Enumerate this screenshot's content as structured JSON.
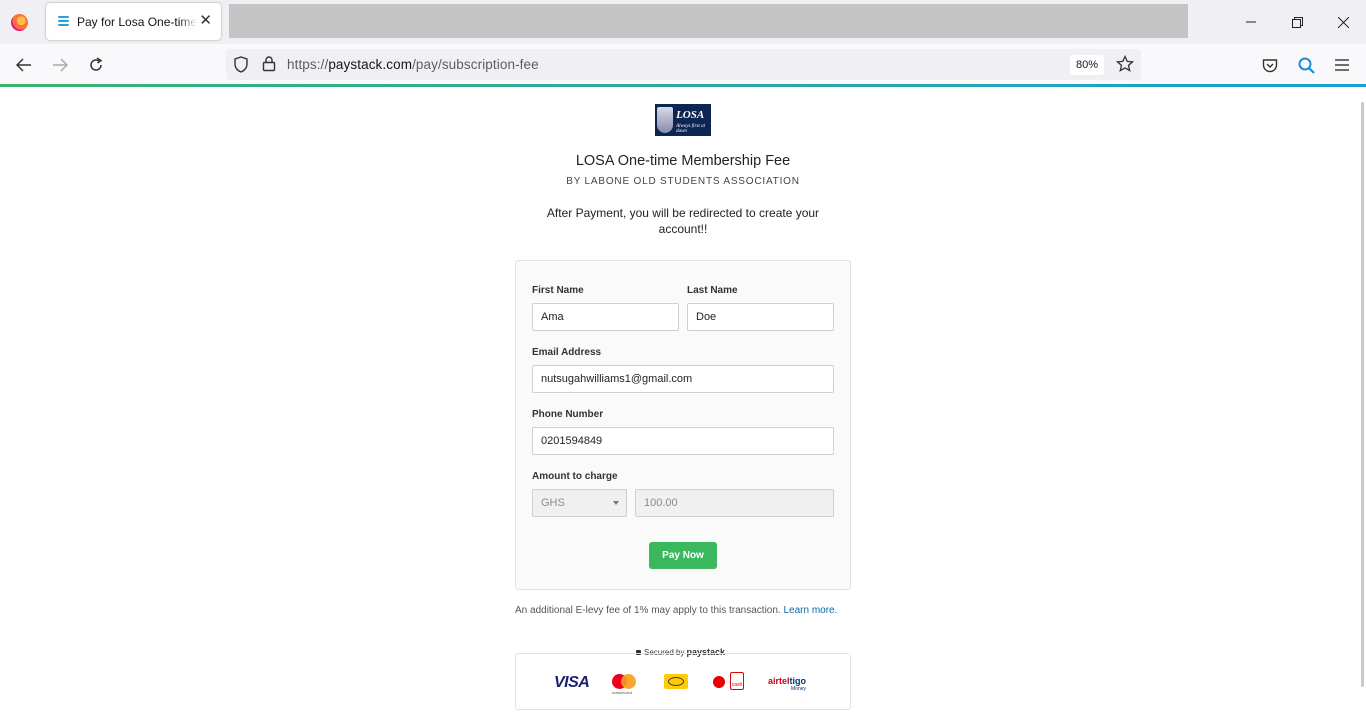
{
  "browser": {
    "tab_title": "Pay for Losa One-time Membership Fee",
    "url_scheme": "https://",
    "url_host": "paystack.com",
    "url_path": "/pay/subscription-fee",
    "zoom": "80%"
  },
  "page": {
    "logo_text": "LOSA",
    "logo_motto": "Always first at dawn",
    "title": "LOSA One-time Membership Fee",
    "subtitle": "BY LABONE OLD STUDENTS ASSOCIATION",
    "note": "After Payment, you will be redirected to create your account!!"
  },
  "form": {
    "first_name_label": "First Name",
    "first_name_value": "Ama",
    "last_name_label": "Last Name",
    "last_name_value": "Doe",
    "email_label": "Email Address",
    "email_value": "nutsugahwilliams1@gmail.com",
    "phone_label": "Phone Number",
    "phone_value": "0201594849",
    "amount_label": "Amount to charge",
    "currency": "GHS",
    "amount_value": "100.00",
    "pay_button": "Pay Now"
  },
  "footer": {
    "levy_text": "An additional E-levy fee of 1% may apply to this transaction.",
    "learn_more": "Learn more.",
    "secured_prefix": "Secured by",
    "secured_brand": "paystack",
    "visa": "VISA",
    "mastercard": "mastercard",
    "vodafone_cash": "cash",
    "airtel": "airtel",
    "tigo": "tigo",
    "airteltigo_money": "Money"
  }
}
